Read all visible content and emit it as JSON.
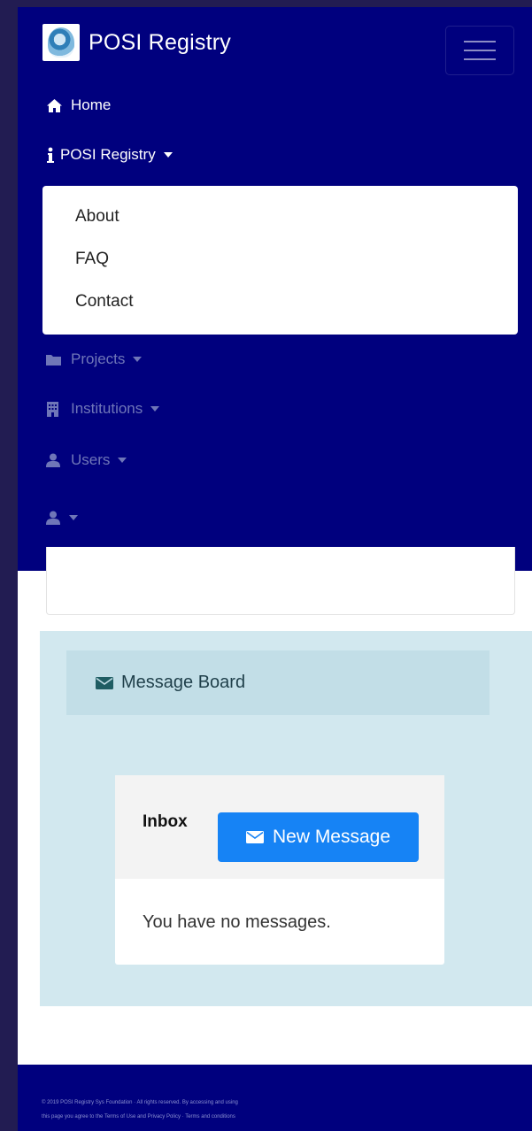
{
  "navbar": {
    "brand_title": "POSI Registry",
    "items": [
      {
        "label": "Home",
        "icon": "home-icon"
      },
      {
        "label": "POSI Registry",
        "icon": "info-icon"
      },
      {
        "label": "Projects",
        "icon": "folder-icon"
      },
      {
        "label": "Institutions",
        "icon": "institution-icon"
      },
      {
        "label": "Users",
        "icon": "user-icon"
      },
      {
        "label": "",
        "icon": "user-icon"
      }
    ],
    "dropdown": [
      "About",
      "FAQ",
      "Contact"
    ]
  },
  "message_board": {
    "title": "Message Board",
    "inbox_label": "Inbox",
    "new_message_label": "New Message",
    "empty_text": "You have no messages."
  },
  "footer": {
    "line1": "© 2019 POSI Registry Sys Foundation · All rights reserved. By accessing and using",
    "line2": "this page you agree to the Terms of Use and Privacy Policy · Terms and conditions"
  },
  "colors": {
    "navbar": "#00007e",
    "page_background": "#221c52",
    "primary_button": "#1683f5",
    "message_board_bg": "#d2e8ef"
  }
}
